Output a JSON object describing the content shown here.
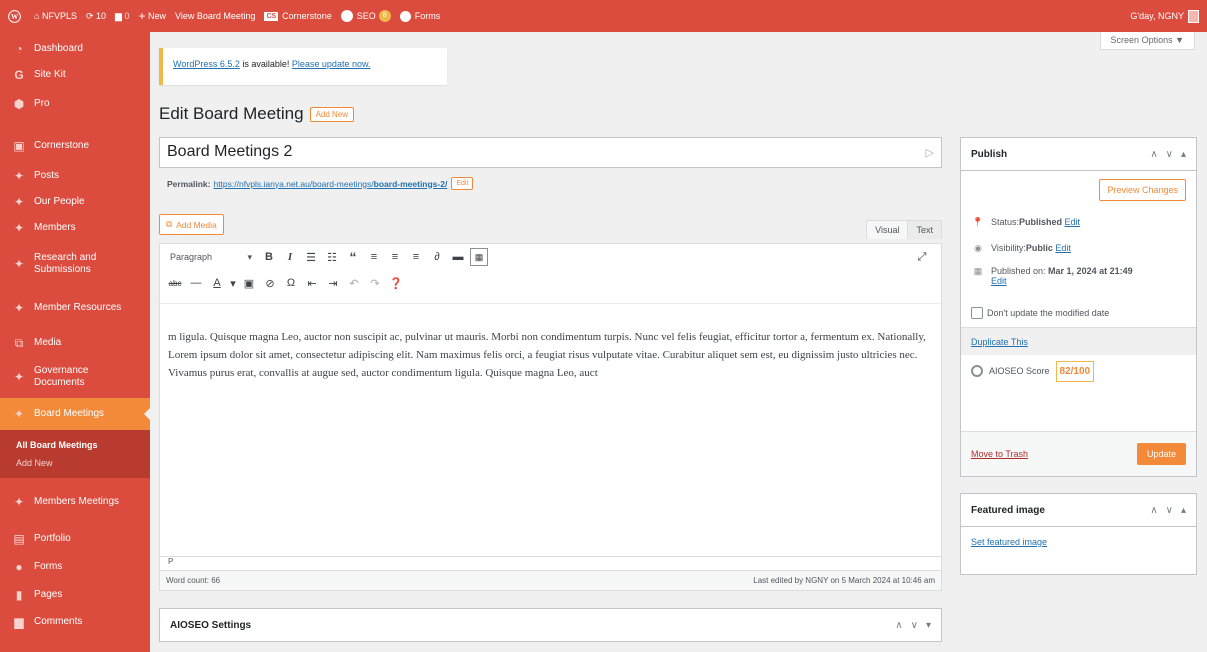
{
  "adminbar": {
    "site_name": "NFVPLS",
    "updates_count": "10",
    "comments_count": "0",
    "new_label": "New",
    "view_label": "View Board Meeting",
    "cornerstone_label": "Cornerstone",
    "seo_label": "SEO",
    "seo_badge": "8",
    "forms_label": "Forms",
    "greeting": "G'day, NGNY"
  },
  "sidebar": {
    "items": [
      {
        "label": "Dashboard",
        "icon": "gauge-icon"
      },
      {
        "label": "Site Kit",
        "icon": "g-icon"
      },
      {
        "label": "Pro",
        "icon": "pro-icon"
      },
      {
        "label": "Cornerstone",
        "icon": "cs-icon"
      },
      {
        "label": "Posts",
        "icon": "pin-icon"
      },
      {
        "label": "Our People",
        "icon": "pin-icon"
      },
      {
        "label": "Members",
        "icon": "pin-icon"
      },
      {
        "label": "Research and Submissions",
        "icon": "pin-icon"
      },
      {
        "label": "Member Resources",
        "icon": "pin-icon"
      },
      {
        "label": "Media",
        "icon": "media-icon"
      },
      {
        "label": "Governance Documents",
        "icon": "pin-icon"
      },
      {
        "label": "Board Meetings",
        "icon": "pin-icon"
      },
      {
        "label": "Members Meetings",
        "icon": "pin-icon"
      },
      {
        "label": "Portfolio",
        "icon": "portfolio-icon"
      },
      {
        "label": "Forms",
        "icon": "forms-icon"
      },
      {
        "label": "Pages",
        "icon": "page-icon"
      },
      {
        "label": "Comments",
        "icon": "comment-icon"
      }
    ],
    "submenu": [
      "All Board Meetings",
      "Add New"
    ]
  },
  "screen_options": "Screen Options ▼",
  "notice": {
    "version_link": "WordPress 6.5.2",
    "middle": " is available! ",
    "update_link": "Please update now."
  },
  "page": {
    "title": "Edit Board Meeting",
    "add_new": "Add New",
    "post_title": "Board Meetings 2",
    "permalink_label": "Permalink:",
    "permalink_base": "https://nfvpls.ianya.net.au/board-meetings/",
    "permalink_slug": "board-meetings-2/",
    "edit_label": "Edit"
  },
  "editor": {
    "add_media": "Add Media",
    "tab_visual": "Visual",
    "tab_text": "Text",
    "format_select": "Paragraph",
    "content": "m ligula. Quisque magna Leo, auctor non suscipit ac, pulvinar ut mauris. Morbi non condimentum turpis. Nunc vel felis feugiat, efficitur tortor a, fermentum ex. Nationally, Lorem ipsum dolor sit amet, consectetur adipiscing elit. Nam maximus felis orci, a feugiat risus vulputate vitae. Curabitur aliquet sem est, eu dignissim justo ultricies nec. Vivamus purus erat, convallis at augue sed, auctor condimentum ligula. Quisque magna Leo, auct",
    "path": "P",
    "word_count": "Word count: 66",
    "last_edited": "Last edited by NGNY on 5 March 2024 at 10:46 am"
  },
  "aioseo_box": {
    "title": "AIOSEO Settings"
  },
  "publish": {
    "title": "Publish",
    "preview": "Preview Changes",
    "status_label": "Status: ",
    "status_value": "Published",
    "visibility_label": "Visibility: ",
    "visibility_value": "Public",
    "published_label": "Published on: ",
    "published_value": "Mar 1, 2024 at 21:49",
    "edit": "Edit",
    "dont_update": "Don't update the modified date",
    "duplicate": "Duplicate This",
    "aioseo_label": "AIOSEO Score",
    "aioseo_score": "82/100",
    "trash": "Move to Trash",
    "update": "Update"
  },
  "featured": {
    "title": "Featured image",
    "set_link": "Set featured image"
  },
  "colors": {
    "admin_red": "#dc4c3e",
    "accent_orange": "#f28a3a",
    "link_blue": "#2271b1"
  }
}
